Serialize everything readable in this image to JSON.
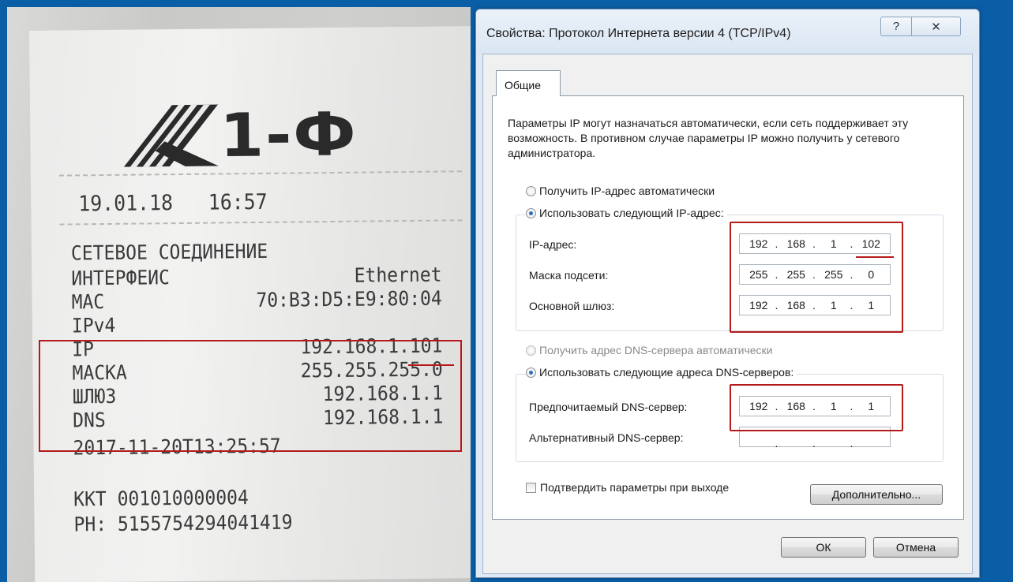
{
  "receipt": {
    "logo_text": "1-Ф",
    "logo_mark_letter": "K",
    "datetime": "19.01.18   16:57",
    "section_title": "СЕТЕВОЕ СОЕДИНЕНИЕ",
    "rows": [
      {
        "label": "ИНТЕРФЕИС",
        "value": "Ethernet"
      },
      {
        "label": "MAC",
        "value": "70:B3:D5:E9:80:04"
      },
      {
        "label": "IPv4",
        "value": ""
      }
    ],
    "network_rows": [
      {
        "label": "IP",
        "value": "192.168.1.101"
      },
      {
        "label": "МАСКА",
        "value": "255.255.255.0"
      },
      {
        "label": "ШЛЮЗ",
        "value": "192.168.1.1"
      },
      {
        "label": "DNS",
        "value": "192.168.1.1"
      }
    ],
    "timestamp": "2017-11-20Т13:25:57",
    "kkt": "ККТ 001010000004",
    "ph": "РН: 5155754294041419"
  },
  "dialog": {
    "title": "Свойства: Протокол Интернета версии 4 (TCP/IPv4)",
    "help_glyph": "?",
    "close_glyph": "✕",
    "tab_label": "Общие",
    "intro": "Параметры IP могут назначаться автоматически, если сеть поддерживает эту возможность. В противном случае параметры IP можно получить у сетевого администратора.",
    "radio_ip_auto": "Получить IP-адрес автоматически",
    "radio_ip_manual": "Использовать следующий IP-адрес:",
    "ip_label": "IP-адрес:",
    "mask_label": "Маска подсети:",
    "gateway_label": "Основной шлюз:",
    "ip_octets": [
      "192",
      "168",
      "1",
      "102"
    ],
    "mask_octets": [
      "255",
      "255",
      "255",
      "0"
    ],
    "gateway_octets": [
      "192",
      "168",
      "1",
      "1"
    ],
    "radio_dns_auto": "Получить адрес DNS-сервера автоматически",
    "radio_dns_manual": "Использовать следующие адреса DNS-серверов:",
    "dns_pref_label": "Предпочитаемый DNS-сервер:",
    "dns_alt_label": "Альтернативный DNS-сервер:",
    "dns_pref_octets": [
      "192",
      "168",
      "1",
      "1"
    ],
    "dns_alt_octets": [
      "",
      "",
      "",
      ""
    ],
    "checkbox_label": "Подтвердить параметры при выходе",
    "advanced_button": "Дополнительно...",
    "ok_button": "ОК",
    "cancel_button": "Отмена"
  },
  "colors": {
    "background": "#0a5ea6",
    "highlight": "#b51a1a"
  }
}
